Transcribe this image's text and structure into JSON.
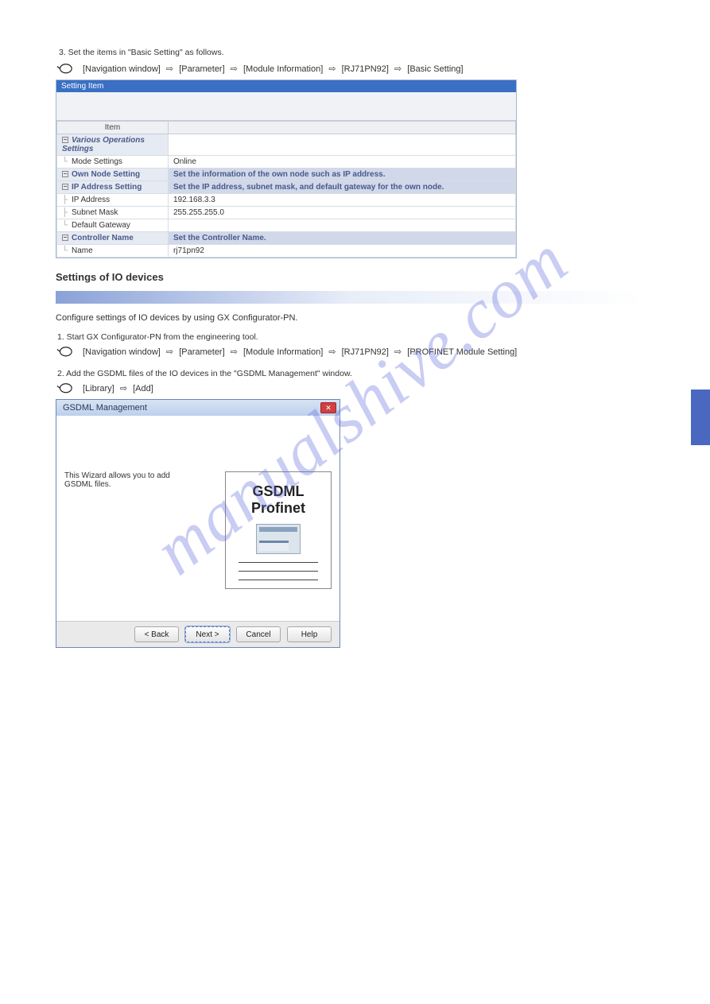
{
  "steps": {
    "s3": "3. Set the items in \"Basic Setting\" as follows.",
    "s3_path": [
      "[Navigation window]",
      "[Parameter]",
      "[Module Information]",
      "[RJ71PN92]",
      "[Basic Setting]"
    ],
    "s4_heading": "Settings of IO devices",
    "s4_text": "Configure settings of IO devices by using GX Configurator-PN.",
    "s4_a": "1. Start GX Configurator-PN from the engineering tool.",
    "s4_a_path": [
      "[Navigation window]",
      "[Parameter]",
      "[Module Information]",
      "[RJ71PN92]",
      "[PROFINET Module Setting]"
    ],
    "s4_b": "2. Add the GSDML files of the IO devices in the \"GSDML Management\" window.",
    "s4_b_path": [
      "[Library]",
      "[Add]"
    ]
  },
  "settings": {
    "header": "Setting Item",
    "col_item": "Item",
    "rows": {
      "various": "Various Operations Settings",
      "mode_label": "Mode Settings",
      "mode_value": "Online",
      "own_node": "Own Node Setting",
      "own_node_desc": "Set the information of the own node such as IP address.",
      "ip_setting": "IP Address Setting",
      "ip_setting_desc": "Set the IP address, subnet mask, and default gateway for the own node.",
      "ip_label": "IP Address",
      "ip_value": "192.168.3.3",
      "subnet_label": "Subnet Mask",
      "subnet_value": "255.255.255.0",
      "gw_label": "Default Gateway",
      "gw_value": "",
      "ctrl_name": "Controller Name",
      "ctrl_name_desc": "Set the Controller Name.",
      "name_label": "Name",
      "name_value": "rj71pn92"
    }
  },
  "dialog": {
    "title": "GSDML Management",
    "wizard_text": "This Wizard allows you to add GSDML files.",
    "card_line1": "GSDML",
    "card_line2": "Profinet",
    "btn_back": "< Back",
    "btn_next": "Next >",
    "btn_cancel": "Cancel",
    "btn_help": "Help"
  },
  "watermark": "manualshive.com"
}
